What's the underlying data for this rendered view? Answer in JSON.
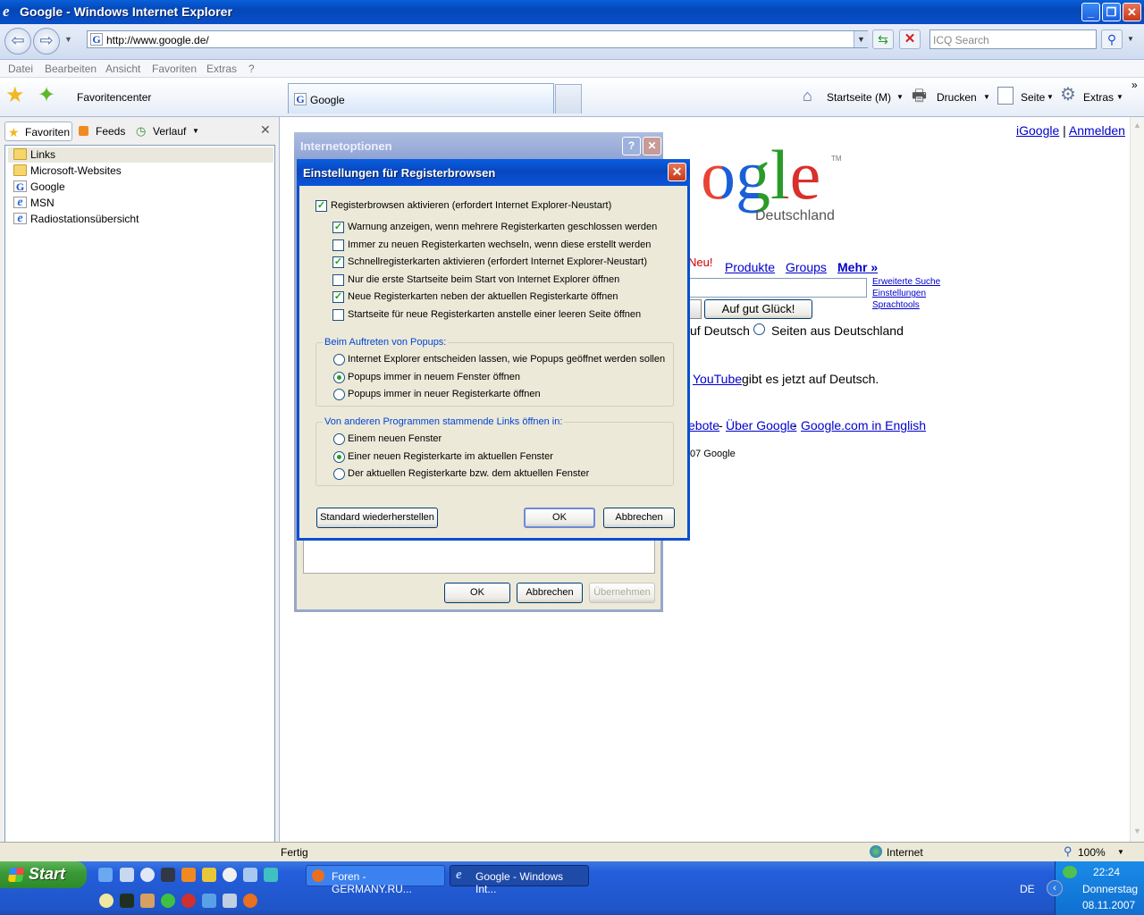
{
  "window": {
    "title": "Google - Windows Internet Explorer"
  },
  "address": {
    "url": "http://www.google.de/",
    "search_placeholder": "ICQ Search"
  },
  "menu": [
    "Datei",
    "Bearbeiten",
    "Ansicht",
    "Favoriten",
    "Extras",
    "?"
  ],
  "toolbar": {
    "favcenter": "Favoritencenter",
    "tab_title": "Google",
    "home": "Startseite (M)",
    "print": "Drucken",
    "page": "Seite",
    "tools": "Extras"
  },
  "favpane": {
    "tabs": [
      "Favoriten",
      "Feeds",
      "Verlauf"
    ],
    "items": [
      "Links",
      "Microsoft-Websites",
      "Google",
      "MSN",
      "Radiostationsübersicht"
    ]
  },
  "google": {
    "top_links": [
      "iGoogle",
      "Anmelden"
    ],
    "logo_partial": "ogle",
    "logo_tm": "TM",
    "logo_sub": "Deutschland",
    "neu": "Neu!",
    "nav": [
      "Produkte",
      "Groups",
      "Mehr »"
    ],
    "side_links": [
      "Erweiterte Suche",
      "Einstellungen",
      "Sprachtools"
    ],
    "lucky": "Auf gut Glück!",
    "radio_partial": "uf Deutsch",
    "radio_de": "Seiten aus Deutschland",
    "youtube_link": "YouTube",
    "youtube_text": "gibt es jetzt auf Deutsch.",
    "footer_partial": "ebote",
    "footer_links": [
      "Über Google",
      "Google.com in English"
    ],
    "copyright_partial": "07 Google"
  },
  "dlg_back": {
    "title": "Internetoptionen",
    "ok": "OK",
    "cancel": "Abbrechen",
    "apply": "Übernehmen"
  },
  "dlg": {
    "title": "Einstellungen für Registerbrowsen",
    "main_check": {
      "label": "Registerbrowsen aktivieren (erfordert Internet Explorer-Neustart)",
      "checked": true
    },
    "checks": [
      {
        "label": "Warnung anzeigen, wenn mehrere Registerkarten geschlossen werden",
        "checked": true
      },
      {
        "label": "Immer zu neuen Registerkarten wechseln, wenn diese erstellt werden",
        "checked": false
      },
      {
        "label": "Schnellregisterkarten aktivieren (erfordert Internet Explorer-Neustart)",
        "checked": true
      },
      {
        "label": "Nur die erste Startseite beim Start von Internet Explorer öffnen",
        "checked": false
      },
      {
        "label": "Neue Registerkarten neben der aktuellen Registerkarte öffnen",
        "checked": true
      },
      {
        "label": "Startseite für neue Registerkarten anstelle einer leeren Seite öffnen",
        "checked": false
      }
    ],
    "popup_group": {
      "label": "Beim Auftreten von Popups:",
      "options": [
        "Internet Explorer entscheiden lassen, wie Popups geöffnet werden sollen",
        "Popups immer in neuem Fenster öffnen",
        "Popups immer in neuer Registerkarte öffnen"
      ],
      "selected": 1
    },
    "links_group": {
      "label": "Von anderen Programmen stammende Links öffnen in:",
      "options": [
        "Einem neuen Fenster",
        "Einer neuen Registerkarte im aktuellen Fenster",
        "Der aktuellen Registerkarte bzw. dem aktuellen Fenster"
      ],
      "selected": 1
    },
    "restore": "Standard wiederherstellen",
    "ok": "OK",
    "cancel": "Abbrechen"
  },
  "status": {
    "text": "Fertig",
    "zone": "Internet",
    "zoom": "100%"
  },
  "taskbar": {
    "start": "Start",
    "tasks": [
      "Foren - GERMANY.RU...",
      "Google - Windows Int..."
    ],
    "lang": "DE",
    "time": "22:24",
    "day": "Donnerstag",
    "date": "08.11.2007"
  },
  "colors": {
    "accent": "#0a4fd0",
    "link": "#0000cc",
    "check": "#21a121"
  }
}
